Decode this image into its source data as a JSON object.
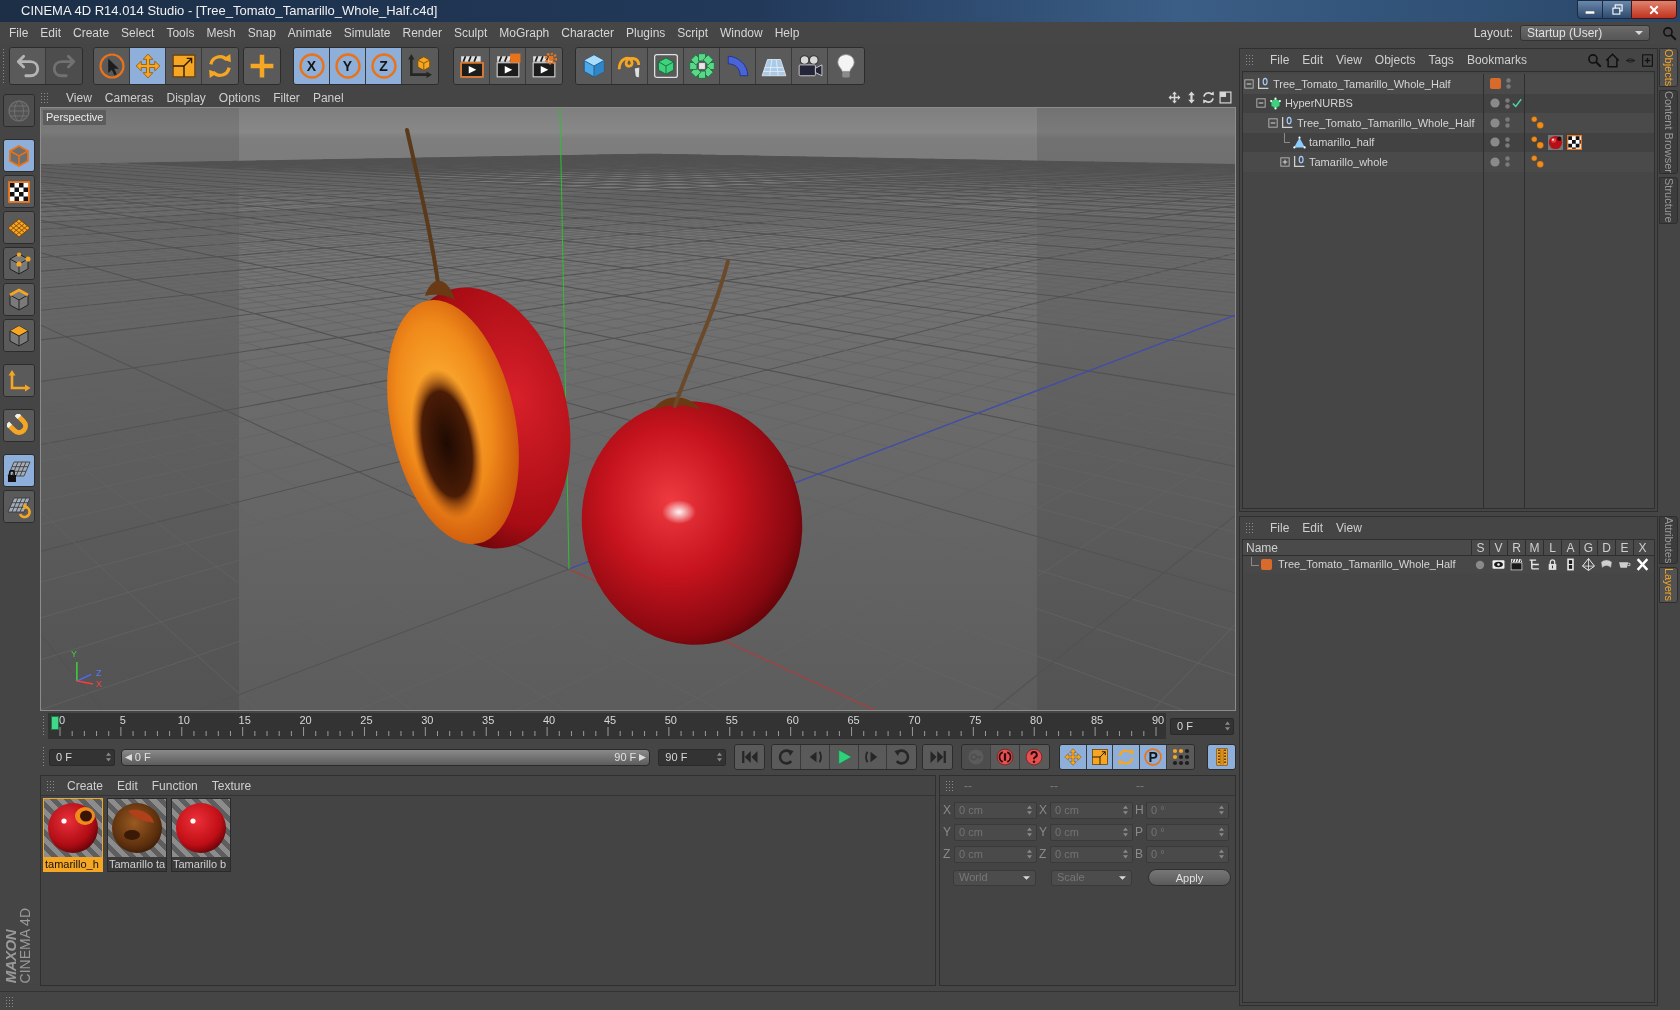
{
  "window": {
    "title": "CINEMA 4D R14.014 Studio - [Tree_Tomato_Tamarillo_Whole_Half.c4d]"
  },
  "menu_bar": {
    "items": [
      "File",
      "Edit",
      "Create",
      "Select",
      "Tools",
      "Mesh",
      "Snap",
      "Animate",
      "Simulate",
      "Render",
      "Sculpt",
      "MoGraph",
      "Character",
      "Plugins",
      "Script",
      "Window",
      "Help"
    ],
    "layout_label": "Layout:",
    "layout_value": "Startup (User)"
  },
  "toolbar": {
    "groups": [
      [
        {
          "kind": "undo",
          "disabled": false
        },
        {
          "kind": "redo",
          "disabled": true
        }
      ],
      [
        {
          "kind": "select",
          "selected": false
        },
        {
          "kind": "move",
          "selected": true
        },
        {
          "kind": "scale",
          "selected": false
        },
        {
          "kind": "rotate",
          "selected": false
        }
      ],
      [
        {
          "kind": "add",
          "selected": false
        }
      ],
      [
        {
          "kind": "axis",
          "label": "X",
          "selected": true
        },
        {
          "kind": "axis",
          "label": "Y",
          "selected": true
        },
        {
          "kind": "axis",
          "label": "Z",
          "selected": true
        },
        {
          "kind": "coords",
          "selected": false
        }
      ],
      [
        {
          "kind": "renderview"
        },
        {
          "kind": "renderpicture"
        },
        {
          "kind": "rendersettings"
        }
      ],
      [
        {
          "kind": "cube"
        },
        {
          "kind": "spline"
        },
        {
          "kind": "nurbs"
        },
        {
          "kind": "cloner"
        },
        {
          "kind": "deformer"
        },
        {
          "kind": "floor"
        },
        {
          "kind": "camera"
        },
        {
          "kind": "light"
        }
      ]
    ]
  },
  "left_toolbar": {
    "groups": [
      [
        {
          "kind": "editable",
          "disabled": true
        }
      ],
      [
        {
          "kind": "model",
          "selected": true
        },
        {
          "kind": "texture",
          "selected": false
        },
        {
          "kind": "workplane",
          "selected": false
        },
        {
          "kind": "points",
          "selected": false
        },
        {
          "kind": "edges",
          "selected": false
        },
        {
          "kind": "polygons",
          "selected": false
        }
      ],
      [
        {
          "kind": "objectaxis",
          "selected": false
        }
      ],
      [
        {
          "kind": "magnet",
          "selected": false
        }
      ],
      [
        {
          "kind": "gridlock",
          "selected": true
        },
        {
          "kind": "gridrotate",
          "selected": false
        }
      ]
    ]
  },
  "viewport": {
    "menu": [
      "View",
      "Cameras",
      "Display",
      "Options",
      "Filter",
      "Panel"
    ],
    "camera": "Perspective",
    "axis_labels": [
      "Y",
      "Z",
      "X"
    ]
  },
  "timeline": {
    "ticks": [
      "0",
      "5",
      "10",
      "15",
      "20",
      "25",
      "30",
      "35",
      "40",
      "45",
      "50",
      "55",
      "60",
      "65",
      "70",
      "75",
      "80",
      "85",
      "90"
    ],
    "level": 0,
    "frame": "0 F"
  },
  "transport": {
    "start": "0 F",
    "range": {
      "start": "0 F",
      "end": "90 F"
    },
    "end": "90 F",
    "groups": [
      [
        {
          "kind": "first"
        }
      ],
      [
        {
          "kind": "prevkey"
        },
        {
          "kind": "prevframe"
        },
        {
          "kind": "play"
        },
        {
          "kind": "nextframe"
        },
        {
          "kind": "nextkey"
        }
      ],
      [
        {
          "kind": "last"
        }
      ],
      [
        {
          "kind": "record",
          "disabled": true
        },
        {
          "kind": "autokey",
          "disabled": false
        },
        {
          "kind": "keyhelp",
          "disabled": false
        }
      ],
      [
        {
          "kind": "move",
          "selected": true
        },
        {
          "kind": "scale",
          "selected": true
        },
        {
          "kind": "rotate",
          "selected": true
        },
        {
          "kind": "param",
          "label": "P",
          "selected": true
        },
        {
          "kind": "dots",
          "selected": false
        }
      ],
      [
        {
          "kind": "timeline",
          "selected": true
        }
      ]
    ]
  },
  "materials": {
    "menu": [
      "Create",
      "Edit",
      "Function",
      "Texture"
    ],
    "items": [
      {
        "name": "tamarillo_h",
        "selected": true
      },
      {
        "name": "Tamarillo ta",
        "selected": false
      },
      {
        "name": "Tamarillo b",
        "selected": false
      }
    ]
  },
  "coordinates": {
    "headers": [
      "--",
      "--",
      "--"
    ],
    "disabled": true,
    "rows": [
      [
        {
          "axis": "X",
          "value": "0 cm"
        },
        {
          "axis": "X",
          "value": "0 cm"
        },
        {
          "axis": "H",
          "value": "0 °"
        }
      ],
      [
        {
          "axis": "Y",
          "value": "0 cm"
        },
        {
          "axis": "Y",
          "value": "0 cm"
        },
        {
          "axis": "P",
          "value": "0 °"
        }
      ],
      [
        {
          "axis": "Z",
          "value": "0 cm"
        },
        {
          "axis": "Z",
          "value": "0 cm"
        },
        {
          "axis": "B",
          "value": "0 °"
        }
      ]
    ],
    "space": "World",
    "size_mode": "Scale",
    "apply": "Apply"
  },
  "object_manager": {
    "menu": [
      "File",
      "Edit",
      "View",
      "Objects",
      "Tags",
      "Bookmarks"
    ],
    "tree": [
      {
        "name": "Tree_Tomato_Tamarillo_Whole_Half",
        "kind": "null",
        "expanded": true,
        "color": "#d86b2c",
        "children": [
          {
            "name": "HyperNURBS",
            "kind": "nurbs",
            "expanded": true,
            "enabled": true,
            "children": [
              {
                "name": "Tree_Tomato_Tamarillo_Whole_Half",
                "kind": "null",
                "expanded": true,
                "tags": [
                  {
                    "kind": "phong"
                  }
                ],
                "children": [
                  {
                    "name": "tamarillo_half",
                    "kind": "polygon",
                    "tags": [
                      {
                        "kind": "phong"
                      },
                      {
                        "kind": "material"
                      },
                      {
                        "kind": "uvw"
                      }
                    ]
                  },
                  {
                    "name": "Tamarillo_whole",
                    "kind": "null",
                    "expanded": false,
                    "tags": [
                      {
                        "kind": "phong"
                      }
                    ]
                  }
                ]
              }
            ]
          }
        ]
      }
    ]
  },
  "layer_manager": {
    "menu": [
      "File",
      "Edit",
      "View"
    ],
    "columns": [
      "Name",
      "S",
      "V",
      "R",
      "M",
      "L",
      "A",
      "G",
      "D",
      "E",
      "X"
    ],
    "rows": [
      {
        "name": "Tree_Tomato_Tamarillo_Whole_Half",
        "color": "#d86b2c"
      }
    ]
  },
  "side_tabs": {
    "top": [
      {
        "label": "Objects",
        "selected": true
      },
      {
        "label": "Content Browser",
        "selected": false
      },
      {
        "label": "Structure",
        "selected": false
      }
    ],
    "bottom": [
      {
        "label": "Attributes",
        "selected": false
      },
      {
        "label": "Layers",
        "selected": true
      }
    ]
  },
  "logo": {
    "brand": "MAXON",
    "product": "CINEMA 4D"
  }
}
